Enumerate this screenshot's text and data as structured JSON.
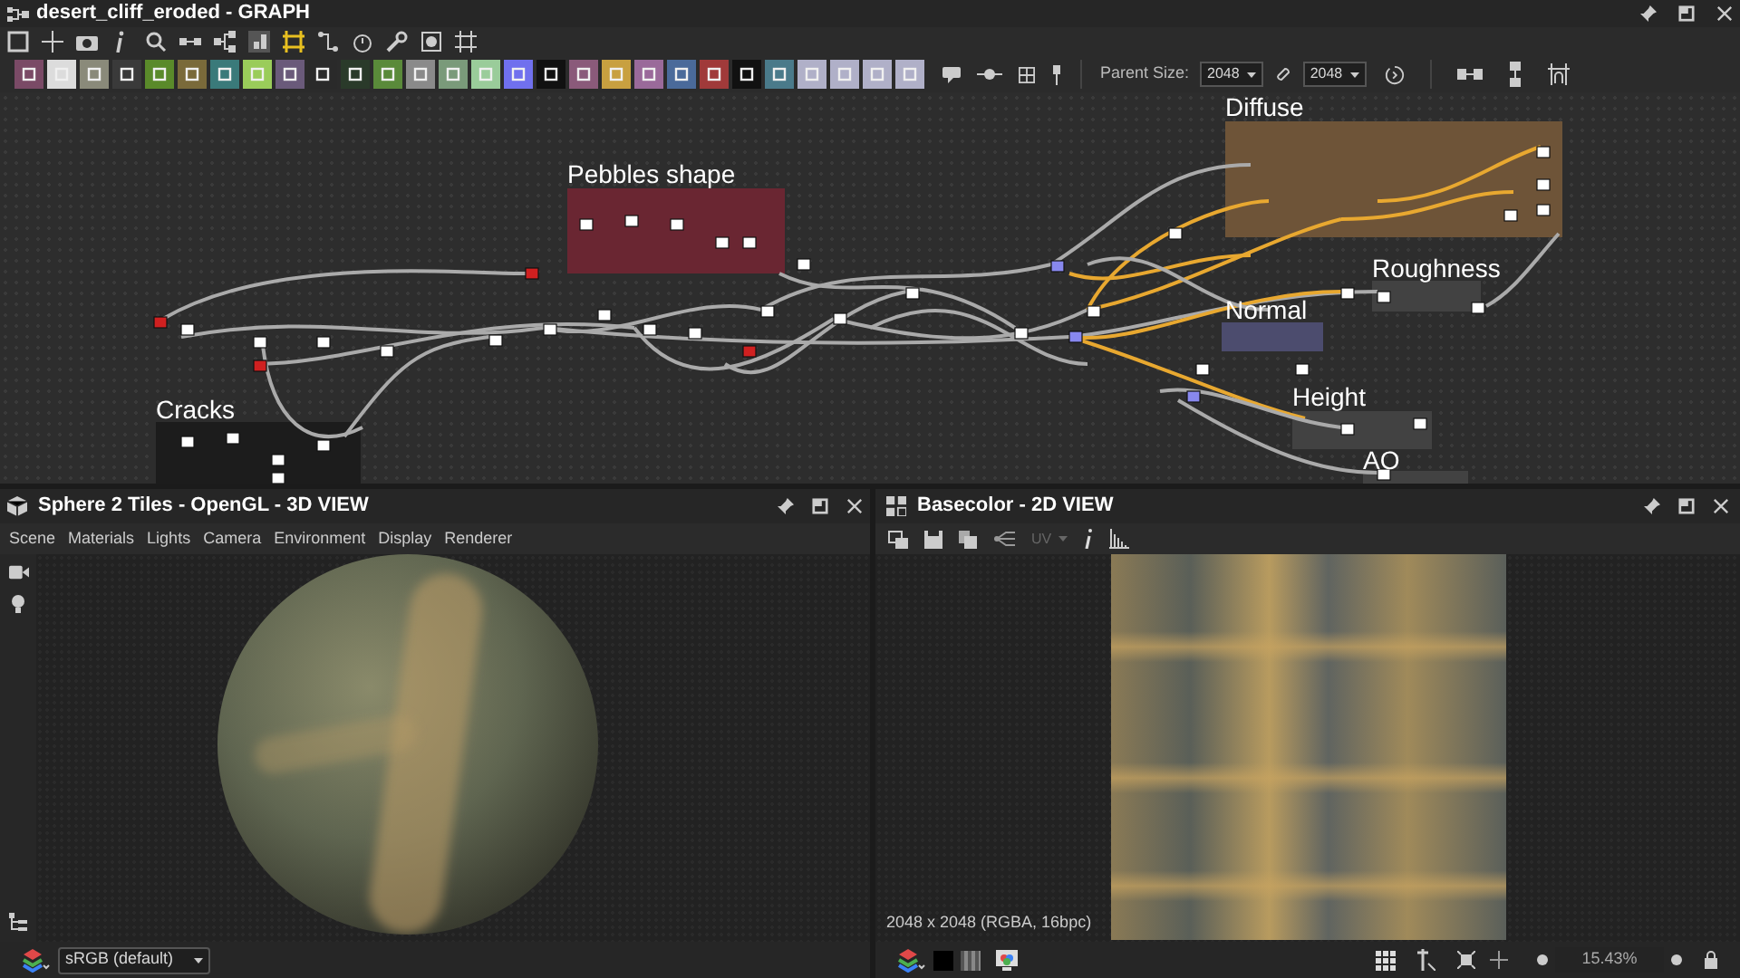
{
  "graph_panel": {
    "title": "desert_cliff_eroded - GRAPH",
    "parent_size_label": "Parent Size:",
    "width_value": "2048",
    "height_value": "2048",
    "frames": [
      {
        "label": "Diffuse",
        "color": "#6e5438"
      },
      {
        "label": "Pebbles shape",
        "color": "#6a2632"
      },
      {
        "label": "Roughness",
        "color": "#424242"
      },
      {
        "label": "Normal",
        "color": "#4c4c6e"
      },
      {
        "label": "Cracks",
        "color": "#1c1c1c"
      },
      {
        "label": "Height",
        "color": "#424242"
      },
      {
        "label": "AO",
        "color": "#424242"
      }
    ]
  },
  "view_3d": {
    "title": "Sphere 2 Tiles - OpenGL - 3D VIEW",
    "menu": [
      "Scene",
      "Materials",
      "Lights",
      "Camera",
      "Environment",
      "Display",
      "Renderer"
    ],
    "color_profile": "sRGB (default)"
  },
  "view_2d": {
    "title": "Basecolor - 2D VIEW",
    "uv_label": "UV",
    "image_info": "2048 x 2048 (RGBA, 16bpc)",
    "zoom": "15.43%"
  }
}
